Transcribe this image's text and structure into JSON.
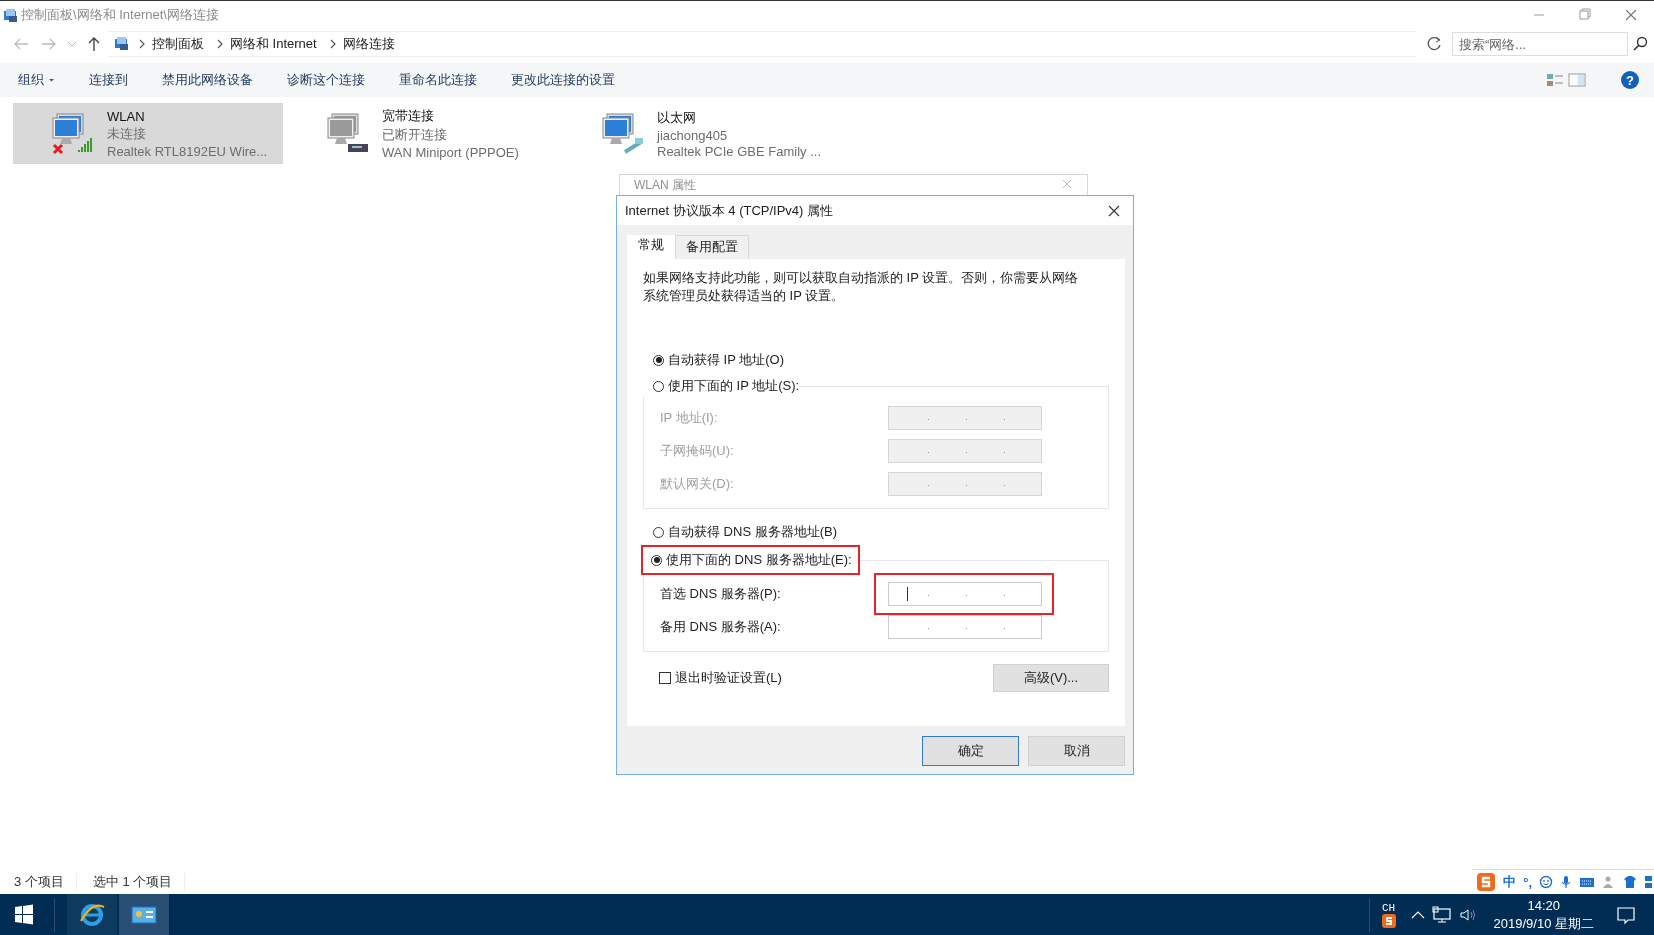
{
  "window": {
    "title": "控制面板\\网络和 Internet\\网络连接"
  },
  "address_bar": {
    "breadcrumbs": [
      "控制面板",
      "网络和 Internet",
      "网络连接"
    ],
    "search": {
      "placeholder": "搜索“网络..."
    }
  },
  "commands": [
    {
      "label": "组织",
      "dropdown": true
    },
    {
      "label": "连接到",
      "dropdown": false
    },
    {
      "label": "禁用此网络设备",
      "dropdown": false
    },
    {
      "label": "诊断这个连接",
      "dropdown": false
    },
    {
      "label": "重命名此连接",
      "dropdown": false
    },
    {
      "label": "更改此连接的设置",
      "dropdown": false
    }
  ],
  "help": "?",
  "connections": [
    {
      "name": "WLAN",
      "status": "未连接",
      "device": "Realtek RTL8192EU Wire...",
      "kind": "wireless",
      "selected": true
    },
    {
      "name": "宽带连接",
      "status": "已断开连接",
      "device": "WAN Miniport (PPPOE)",
      "kind": "dialup",
      "selected": false
    },
    {
      "name": "以太网",
      "status": "jiachong405",
      "device": "Realtek PCIe GBE Family ...",
      "kind": "ethernet",
      "selected": false
    }
  ],
  "background_dialog": {
    "title": "WLAN 属性"
  },
  "dialog": {
    "title": "Internet 协议版本 4 (TCP/IPv4) 属性",
    "tabs": [
      {
        "label": "常规",
        "selected": true
      },
      {
        "label": "备用配置",
        "selected": false
      }
    ],
    "description": "如果网络支持此功能，则可以获取自动指派的 IP 设置。否则，你需要从网络系统管理员处获得适当的 IP 设置。",
    "ip_mode": [
      {
        "label": "自动获得 IP 地址(O)",
        "selected": true,
        "highlighted": false
      },
      {
        "label": "使用下面的 IP 地址(S):",
        "selected": false,
        "highlighted": false
      }
    ],
    "ip_fields": [
      {
        "label": "IP 地址(I):",
        "disabled": true,
        "focused": false,
        "highlighted": false
      },
      {
        "label": "子网掩码(U):",
        "disabled": true,
        "focused": false,
        "highlighted": false
      },
      {
        "label": "默认网关(D):",
        "disabled": true,
        "focused": false,
        "highlighted": false
      }
    ],
    "dns_mode": [
      {
        "label": "自动获得 DNS 服务器地址(B)",
        "selected": false,
        "highlighted": false
      },
      {
        "label": "使用下面的 DNS 服务器地址(E):",
        "selected": true,
        "highlighted": true
      }
    ],
    "dns_fields": [
      {
        "label": "首选 DNS 服务器(P):",
        "disabled": false,
        "focused": true,
        "highlighted": true
      },
      {
        "label": "备用 DNS 服务器(A):",
        "disabled": false,
        "focused": false,
        "highlighted": false
      }
    ],
    "validate_on_exit": {
      "label": "退出时验证设置(L)",
      "checked": false
    },
    "advanced_button": "高级(V)...",
    "buttons": [
      {
        "label": "确定",
        "default": true
      },
      {
        "label": "取消",
        "default": false
      }
    ]
  },
  "status_bar": {
    "item_count": "3 个项目",
    "selection": "选中 1 个项目"
  },
  "ime_bar": {
    "mode": "中",
    "punctuation": "°,"
  },
  "taskbar": {
    "apps": [
      {
        "kind": "browser",
        "active": false
      },
      {
        "kind": "control-panel",
        "active": true
      }
    ]
  },
  "tray": {
    "language": "CH",
    "time": "14:20",
    "date": "2019/9/10 星期二"
  }
}
